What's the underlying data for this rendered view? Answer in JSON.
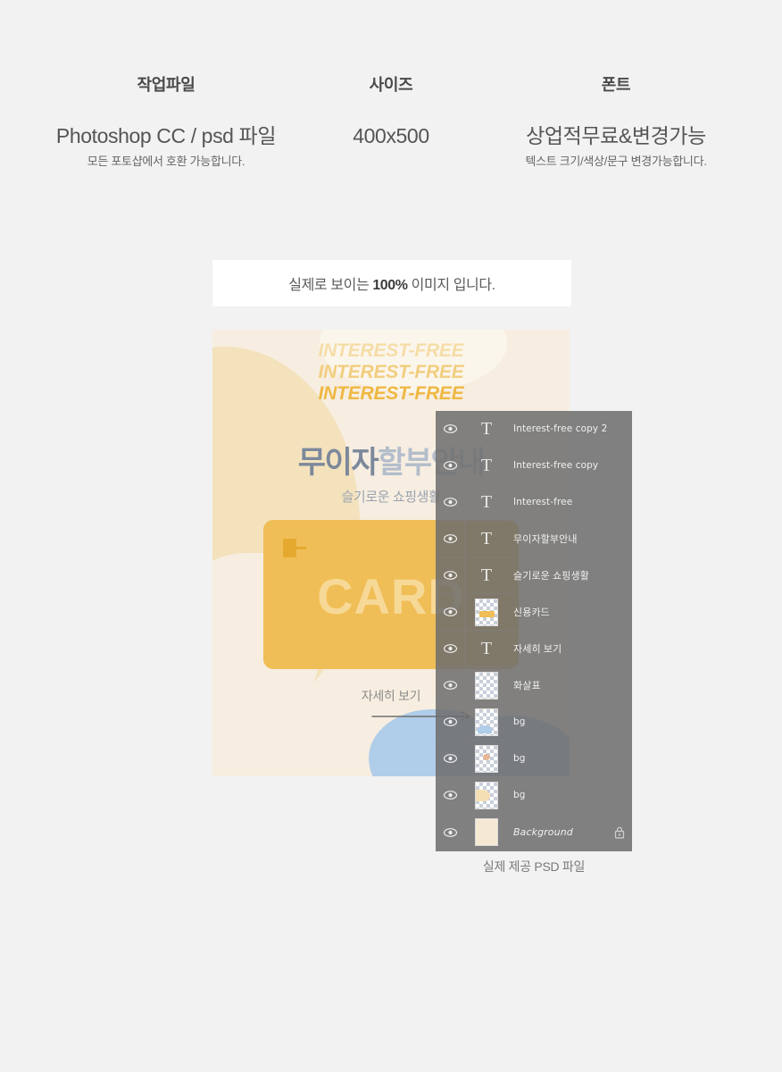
{
  "specs": [
    {
      "title": "작업파일",
      "main": "Photoshop CC / psd 파일",
      "sub": "모든 포토샵에서 호환 가능합니다."
    },
    {
      "title": "사이즈",
      "main": "400x500",
      "sub": ""
    },
    {
      "title": "폰트",
      "main": "상업적무료&변경가능",
      "sub": "텍스트 크기/색상/문구 변경가능합니다."
    }
  ],
  "banner": {
    "prefix": "실제로 보이는 ",
    "highlight": "100%",
    "suffix": " 이미지 입니다."
  },
  "preview": {
    "interest_free_lines": [
      "INTEREST-FREE",
      "INTEREST-FREE",
      "INTEREST-FREE"
    ],
    "headline_dark": "무이자",
    "headline_light": "할부안내",
    "subline": "슬기로운 쇼핑생활",
    "card_word": "CARD",
    "detail_link": "자세히 보기"
  },
  "layers_panel": {
    "rows": [
      {
        "name": "Interest-free copy 2",
        "kind": "text",
        "locked": false,
        "script": "en"
      },
      {
        "name": "Interest-free copy",
        "kind": "text",
        "locked": false,
        "script": "en"
      },
      {
        "name": "Interest-free",
        "kind": "text",
        "locked": false,
        "script": "en"
      },
      {
        "name": "무이자할부안내",
        "kind": "text",
        "locked": false,
        "script": "ko"
      },
      {
        "name": "슬기로운 쇼핑생활",
        "kind": "text",
        "locked": false,
        "script": "ko"
      },
      {
        "name": "신용카드",
        "kind": "image-card",
        "locked": false,
        "script": "ko"
      },
      {
        "name": "자세히 보기",
        "kind": "text",
        "locked": false,
        "script": "ko"
      },
      {
        "name": "화살표",
        "kind": "image-arrow",
        "locked": false,
        "script": "ko"
      },
      {
        "name": "bg",
        "kind": "image-blue",
        "locked": false,
        "script": "en"
      },
      {
        "name": "bg",
        "kind": "image-dot",
        "locked": false,
        "script": "en"
      },
      {
        "name": "bg",
        "kind": "image-beige",
        "locked": false,
        "script": "en"
      },
      {
        "name": "Background",
        "kind": "solid",
        "locked": true,
        "script": "italic"
      }
    ]
  },
  "psd_caption": "실제 제공 PSD 파일",
  "colors": {
    "page_bg": "#f2f2f2",
    "canvas_bg": "#f7eee1",
    "card": "#f0be57",
    "accent_orange": "#efb843",
    "blue_blob": "#b0cde9",
    "panel_bg": "#6d6d6d",
    "headline_dark": "#7c889b",
    "headline_light": "#b3bdcb"
  }
}
